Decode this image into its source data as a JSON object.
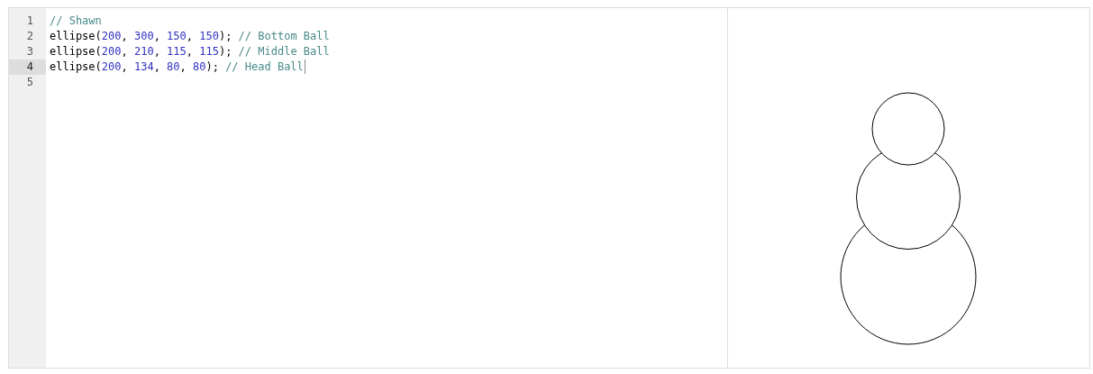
{
  "editor": {
    "lines": [
      {
        "number": "1",
        "active": false,
        "tokens": [
          {
            "kind": "comment",
            "text": "// Shawn"
          }
        ]
      },
      {
        "number": "2",
        "active": false,
        "tokens": [
          {
            "kind": "plain",
            "text": "ellipse("
          },
          {
            "kind": "number",
            "text": "200"
          },
          {
            "kind": "plain",
            "text": ", "
          },
          {
            "kind": "number",
            "text": "300"
          },
          {
            "kind": "plain",
            "text": ", "
          },
          {
            "kind": "number",
            "text": "150"
          },
          {
            "kind": "plain",
            "text": ", "
          },
          {
            "kind": "number",
            "text": "150"
          },
          {
            "kind": "plain",
            "text": "); "
          },
          {
            "kind": "comment",
            "text": "// Bottom Ball"
          }
        ]
      },
      {
        "number": "3",
        "active": false,
        "tokens": [
          {
            "kind": "plain",
            "text": "ellipse("
          },
          {
            "kind": "number",
            "text": "200"
          },
          {
            "kind": "plain",
            "text": ", "
          },
          {
            "kind": "number",
            "text": "210"
          },
          {
            "kind": "plain",
            "text": ", "
          },
          {
            "kind": "number",
            "text": "115"
          },
          {
            "kind": "plain",
            "text": ", "
          },
          {
            "kind": "number",
            "text": "115"
          },
          {
            "kind": "plain",
            "text": "); "
          },
          {
            "kind": "comment",
            "text": "// Middle Ball"
          }
        ]
      },
      {
        "number": "4",
        "active": true,
        "tokens": [
          {
            "kind": "plain",
            "text": "ellipse("
          },
          {
            "kind": "number",
            "text": "200"
          },
          {
            "kind": "plain",
            "text": ", "
          },
          {
            "kind": "number",
            "text": "134"
          },
          {
            "kind": "plain",
            "text": ", "
          },
          {
            "kind": "number",
            "text": "80"
          },
          {
            "kind": "plain",
            "text": ", "
          },
          {
            "kind": "number",
            "text": "80"
          },
          {
            "kind": "plain",
            "text": "); "
          },
          {
            "kind": "comment",
            "text": "// Head Ball"
          }
        ]
      },
      {
        "number": "5",
        "active": false
      }
    ]
  }
}
